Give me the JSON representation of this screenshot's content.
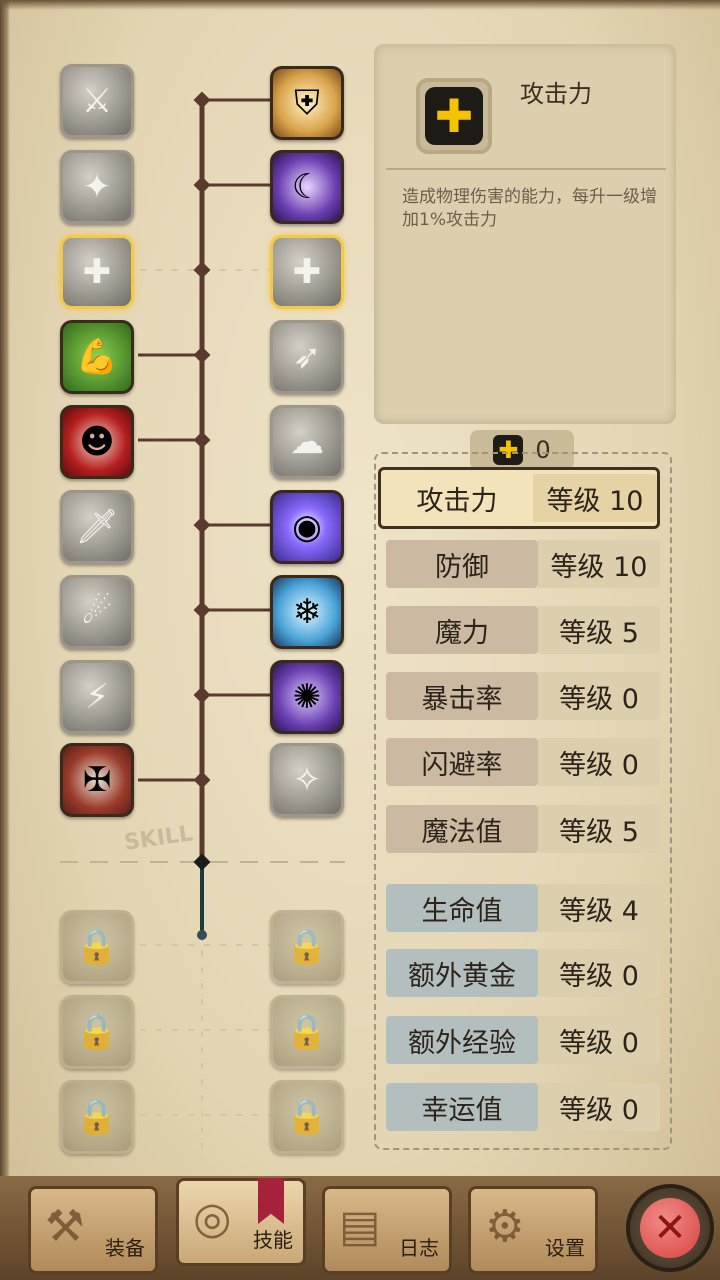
{
  "info": {
    "title": "攻击力",
    "icon": "plus-icon",
    "description": "造成物理伤害的能力，每升一级增加1%攻击力"
  },
  "points": {
    "icon": "plus-icon",
    "value": "0"
  },
  "attributes": [
    {
      "name": "攻击力",
      "level": "等级 10"
    },
    {
      "name": "防御",
      "level": "等级 10"
    },
    {
      "name": "魔力",
      "level": "等级 5"
    },
    {
      "name": "暴击率",
      "level": "等级 0"
    },
    {
      "name": "闪避率",
      "level": "等级 0"
    },
    {
      "name": "魔法值",
      "level": "等级 5"
    },
    {
      "name": "生命值",
      "level": "等级 4"
    },
    {
      "name": "额外黄金",
      "level": "等级 0"
    },
    {
      "name": "额外经验",
      "level": "等级 0"
    },
    {
      "name": "幸运值",
      "level": "等级 0"
    }
  ],
  "skill_watermark": "SKILL",
  "tabs": [
    {
      "label": "装备",
      "icon": "axe-icon"
    },
    {
      "label": "技能",
      "icon": "skill-ring-icon"
    },
    {
      "label": "日志",
      "icon": "journal-icon"
    },
    {
      "label": "设置",
      "icon": "gear-icon"
    }
  ],
  "close_icon": "close-icon",
  "colors": {
    "accent_gold": "#f5c400",
    "selected_border": "#f2c94c",
    "close_red": "#d9433f"
  }
}
